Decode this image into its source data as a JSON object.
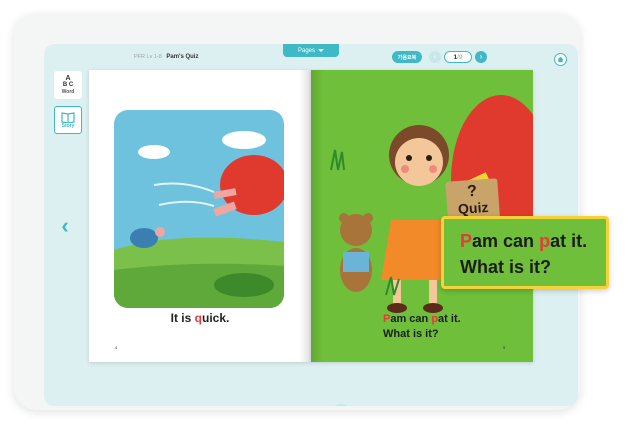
{
  "header": {
    "pages_tab_label": "Pages",
    "book_level": "PFR Lv 1-8",
    "book_title": "Pam's Quiz",
    "action_pill_label": "가음요북",
    "page_current": "1",
    "page_total": "/9"
  },
  "sidebar": {
    "word_label": "Word",
    "word_glyph_a": "A",
    "word_glyph_bc": "B C",
    "story_label": "Story"
  },
  "book": {
    "left_page": {
      "caption_pre": "It is ",
      "caption_highlight": "q",
      "caption_post": "uick.",
      "page_number": "4"
    },
    "right_page": {
      "sign_q": "?",
      "sign_word": "Quiz",
      "line1_a": "P",
      "line1_b": "am can ",
      "line1_c": "p",
      "line1_d": "at it.",
      "line2": "What is it?",
      "page_number": "5"
    }
  },
  "zoom": {
    "line1_a": "P",
    "line1_b": "am can ",
    "line1_c": "p",
    "line1_d": "at it.",
    "line2": "What is it?"
  },
  "colors": {
    "accent": "#3fb9c6",
    "highlight_letter": "#e83a3a",
    "zoom_border": "#f5d23a",
    "right_page_bg": "#6fbf3a"
  },
  "icons": {
    "prev": "chevron-left-icon",
    "next": "chevron-right-icon",
    "home": "home-icon",
    "mic": "microphone-icon",
    "story": "book-icon",
    "word": "abc-icon"
  }
}
